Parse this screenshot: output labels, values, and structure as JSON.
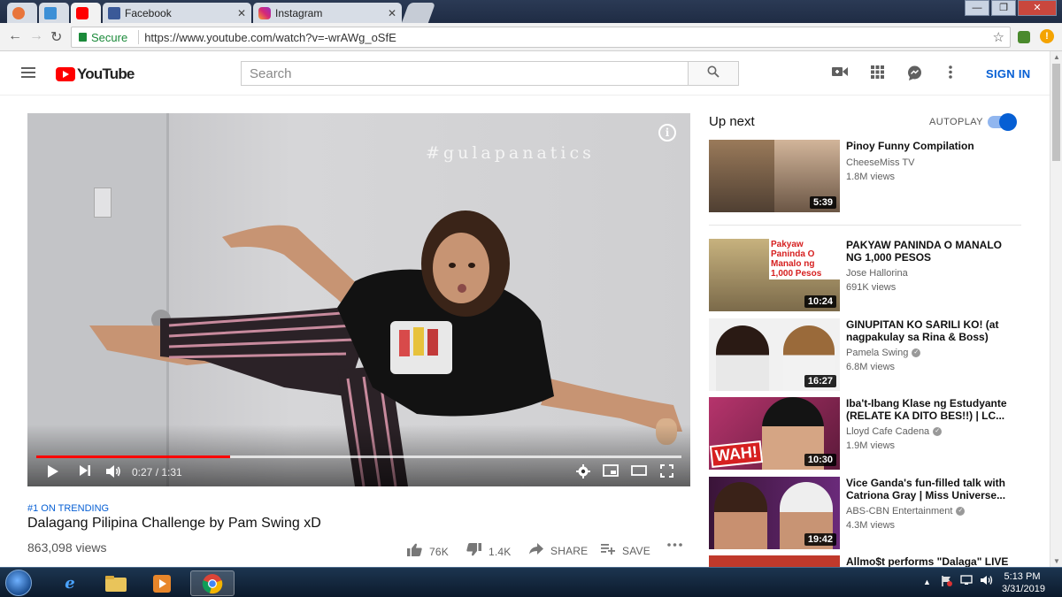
{
  "browser": {
    "tabs": [
      {
        "label": ""
      },
      {
        "label": ""
      },
      {
        "label": ""
      },
      {
        "label": "Facebook"
      },
      {
        "label": "Instagram"
      }
    ],
    "secure_label": "Secure",
    "url": "https://www.youtube.com/watch?v=-wrAWg_oSfE",
    "colors": {
      "secure": "#1b8a3a"
    }
  },
  "header": {
    "logo_text": "YouTube",
    "search_placeholder": "Search",
    "sign_in": "SIGN IN",
    "icons": [
      "menu-icon",
      "search-icon",
      "upload-video-icon",
      "apps-grid-icon",
      "messages-icon",
      "more-vert-icon"
    ],
    "colors": {
      "brand": "#ff0000",
      "link": "#065fd4"
    }
  },
  "player": {
    "overlay_text": "#gulapanatics",
    "current_time": "0:27",
    "duration": "1:31",
    "time_display": "0:27 / 1:31",
    "progress_fraction": 0.3,
    "buffered_fraction": 1.0
  },
  "video": {
    "trending": "#1 ON TRENDING",
    "title": "Dalagang Pilipina Challenge by Pam Swing xD",
    "views": "863,098 views",
    "likes": "76K",
    "dislikes": "1.4K",
    "share": "SHARE",
    "save": "SAVE"
  },
  "sidebar": {
    "up_next": "Up next",
    "autoplay": "AUTOPLAY",
    "autoplay_on": true,
    "items": [
      {
        "title": "Pinoy Funny Compilation",
        "channel": "CheeseMiss TV",
        "views": "1.8M views",
        "duration": "5:39",
        "verified": false
      },
      {
        "title": "PAKYAW PANINDA O MANALO NG 1,000 PESOS",
        "channel": "Jose Hallorina",
        "views": "691K views",
        "duration": "10:24",
        "verified": false,
        "thumb_text": "Pakyaw Paninda O Manalo ng 1,000 Pesos"
      },
      {
        "title": "GINUPITAN KO SARILI KO! (at nagpakulay sa Rina & Boss)",
        "channel": "Pamela Swing",
        "views": "6.8M views",
        "duration": "16:27",
        "verified": true
      },
      {
        "title": "Iba't-Ibang Klase ng Estudyante (RELATE KA DITO BES!!) | LC...",
        "channel": "Lloyd Cafe Cadena",
        "views": "1.9M views",
        "duration": "10:30",
        "verified": true,
        "thumb_text": "WAH!"
      },
      {
        "title": "Vice Ganda's fun-filled talk with Catriona Gray | Miss Universe...",
        "channel": "ABS-CBN Entertainment",
        "views": "4.3M views",
        "duration": "19:42",
        "verified": true
      },
      {
        "title": "Allmo$t performs \"Dalaga\" LIVE",
        "channel": "",
        "views": "",
        "duration": "",
        "verified": false
      }
    ]
  },
  "taskbar": {
    "time": "5:13 PM",
    "date": "3/31/2019"
  }
}
